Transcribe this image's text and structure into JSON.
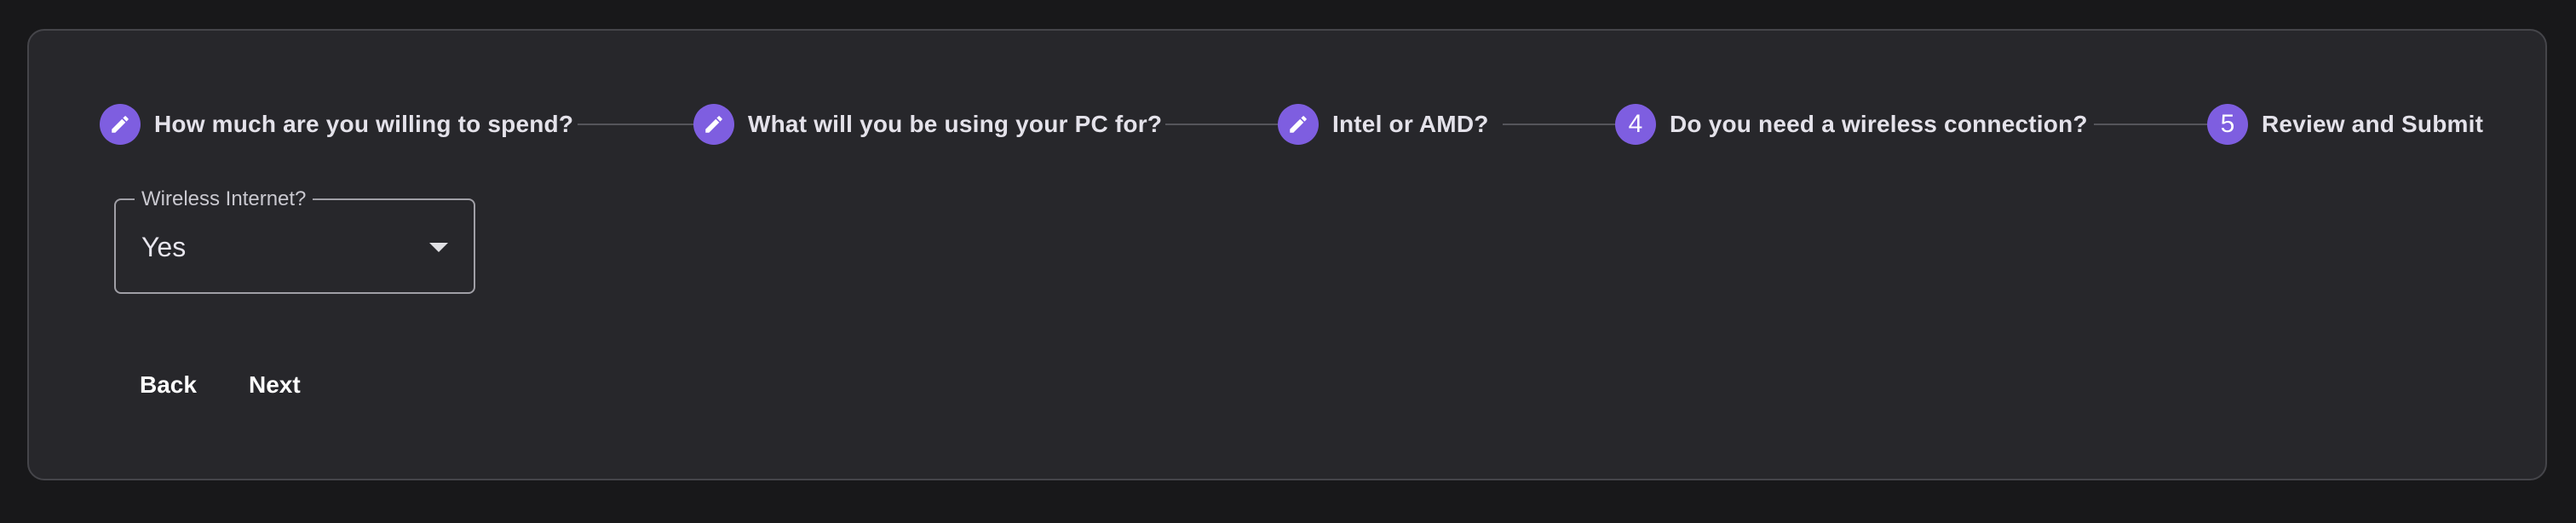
{
  "colors": {
    "page_background": "#18181a",
    "card_background": "#27272b",
    "accent": "#7e5ee0",
    "text": "#e4e2ea"
  },
  "stepper": {
    "steps": [
      {
        "label": "How much are you willing to spend?",
        "state": "completed",
        "icon": "pencil-icon",
        "number": "1"
      },
      {
        "label": "What will you be using your PC for?",
        "state": "completed",
        "icon": "pencil-icon",
        "number": "2"
      },
      {
        "label": "Intel or AMD?",
        "state": "completed",
        "icon": "pencil-icon",
        "number": "3"
      },
      {
        "label": "Do you need a wireless connection?",
        "state": "active",
        "number": "4"
      },
      {
        "label": "Review and Submit",
        "state": "upcoming",
        "number": "5"
      }
    ]
  },
  "form": {
    "wireless_label": "Wireless Internet?",
    "wireless_value": "Yes"
  },
  "actions": {
    "back_label": "Back",
    "next_label": "Next"
  }
}
